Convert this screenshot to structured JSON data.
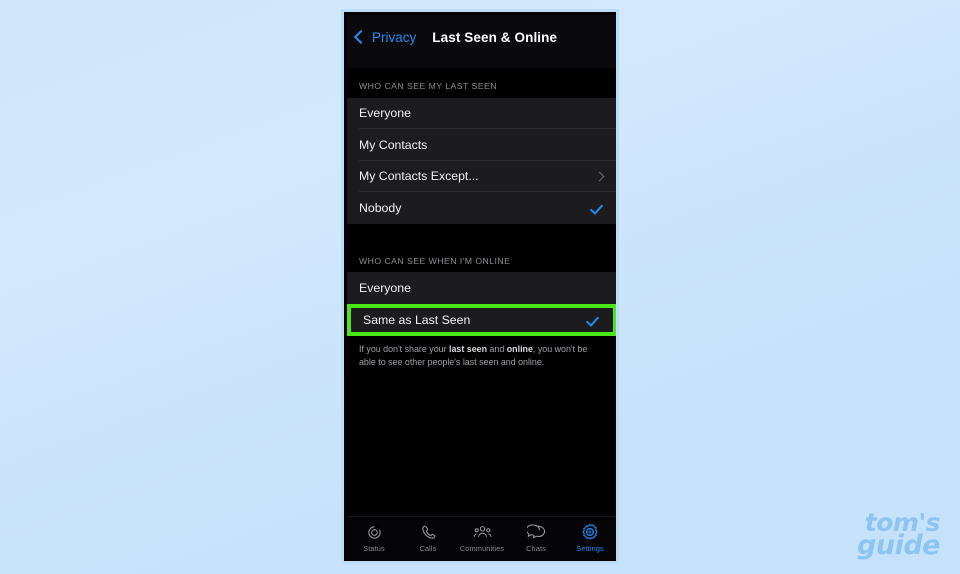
{
  "watermark": {
    "line1": "tom's",
    "line2": "guide",
    "color": "#8cc4f2"
  },
  "phone": {
    "nav": {
      "back_label": "Privacy",
      "back_icon": "chevron-left-icon",
      "title": "Last Seen & Online",
      "accent_color": "#1f8df5"
    },
    "sections": [
      {
        "header": "WHO CAN SEE MY LAST SEEN",
        "rows": [
          {
            "label": "Everyone",
            "accessory": "none"
          },
          {
            "label": "My Contacts",
            "accessory": "none"
          },
          {
            "label": "My Contacts Except...",
            "accessory": "chevron"
          },
          {
            "label": "Nobody",
            "accessory": "check"
          }
        ]
      },
      {
        "header": "WHO CAN SEE WHEN I'M ONLINE",
        "rows": [
          {
            "label": "Everyone",
            "accessory": "none"
          },
          {
            "label": "Same as Last Seen",
            "accessory": "check",
            "highlighted": true
          }
        ]
      }
    ],
    "footnote": {
      "part1": "If you don't share your ",
      "bold1": "last seen",
      "part2": " and ",
      "bold2": "online",
      "part3": ", you won't be able to see other people's last seen and online."
    },
    "highlight_color": "#49e61a",
    "tabbar": [
      {
        "label": "Status",
        "icon": "status-rings-icon",
        "active": false
      },
      {
        "label": "Calls",
        "icon": "phone-handset-icon",
        "active": false
      },
      {
        "label": "Communities",
        "icon": "communities-people-icon",
        "active": false
      },
      {
        "label": "Chats",
        "icon": "chat-bubbles-icon",
        "active": false
      },
      {
        "label": "Settings",
        "icon": "gear-icon",
        "active": true
      }
    ]
  }
}
